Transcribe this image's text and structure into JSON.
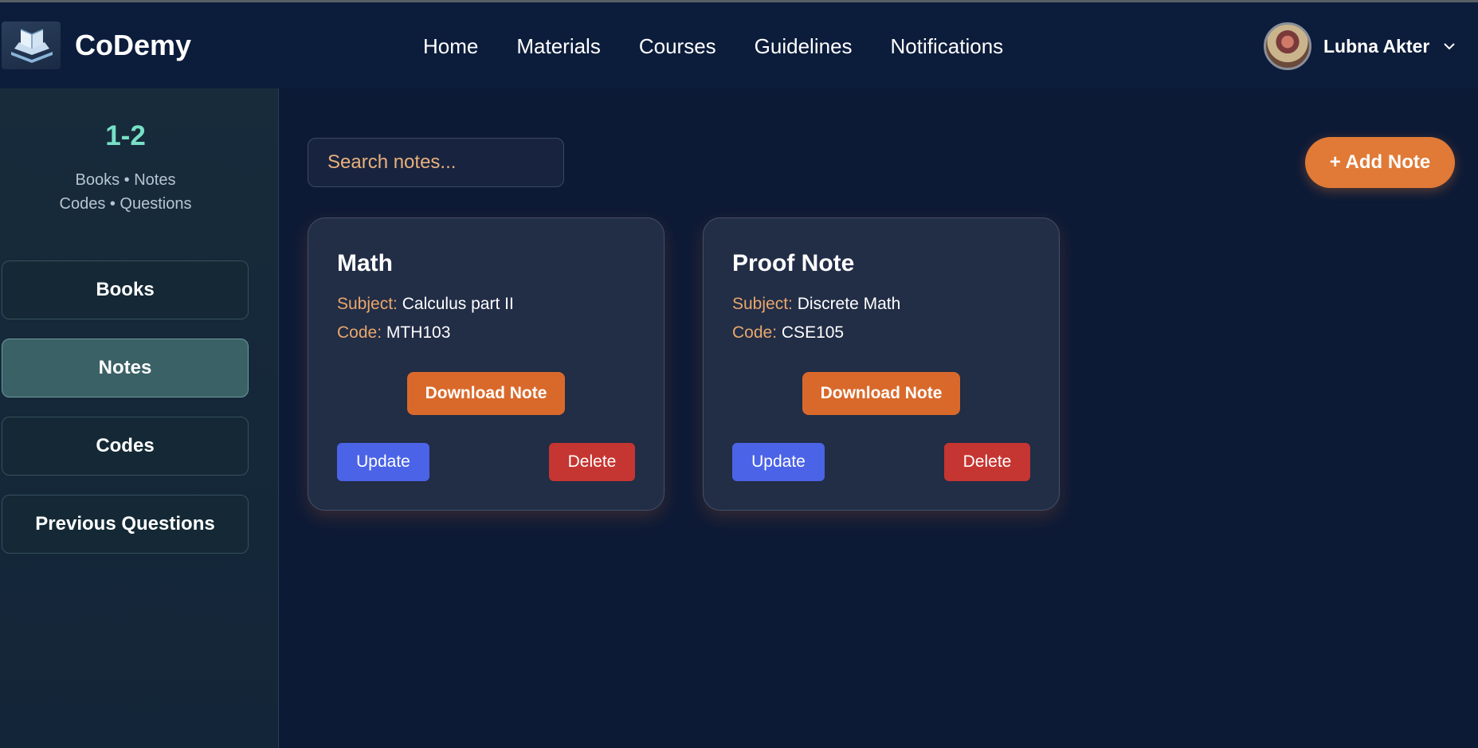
{
  "app": {
    "name": "CoDemy"
  },
  "nav": [
    "Home",
    "Materials",
    "Courses",
    "Guidelines",
    "Notifications"
  ],
  "user": {
    "name": "Lubna Akter"
  },
  "sidebar": {
    "title": "1-2",
    "subtitle_line1": "Books • Notes",
    "subtitle_line2": "Codes • Questions",
    "items": [
      {
        "label": "Books",
        "active": false
      },
      {
        "label": "Notes",
        "active": true
      },
      {
        "label": "Codes",
        "active": false
      },
      {
        "label": "Previous Questions",
        "active": false
      }
    ]
  },
  "search": {
    "placeholder": "Search notes...",
    "value": ""
  },
  "add_button": "+ Add Note",
  "notes": [
    {
      "title": "Math",
      "subject_label": "Subject:",
      "subject": "Calculus part II",
      "code_label": "Code:",
      "code": "MTH103",
      "download_label": "Download Note",
      "update_label": "Update",
      "delete_label": "Delete"
    },
    {
      "title": "Proof Note",
      "subject_label": "Subject:",
      "subject": "Discrete Math",
      "code_label": "Code:",
      "code": "CSE105",
      "download_label": "Download Note",
      "update_label": "Update",
      "delete_label": "Delete"
    }
  ],
  "colors": {
    "accent": "#e07a36",
    "update": "#4b63e6",
    "delete": "#c53531",
    "sidebar_title": "#77e0c6",
    "label": "#e8a86c"
  },
  "icons": {
    "logo": "book-laptop-icon",
    "dropdown": "chevron-down-icon"
  }
}
